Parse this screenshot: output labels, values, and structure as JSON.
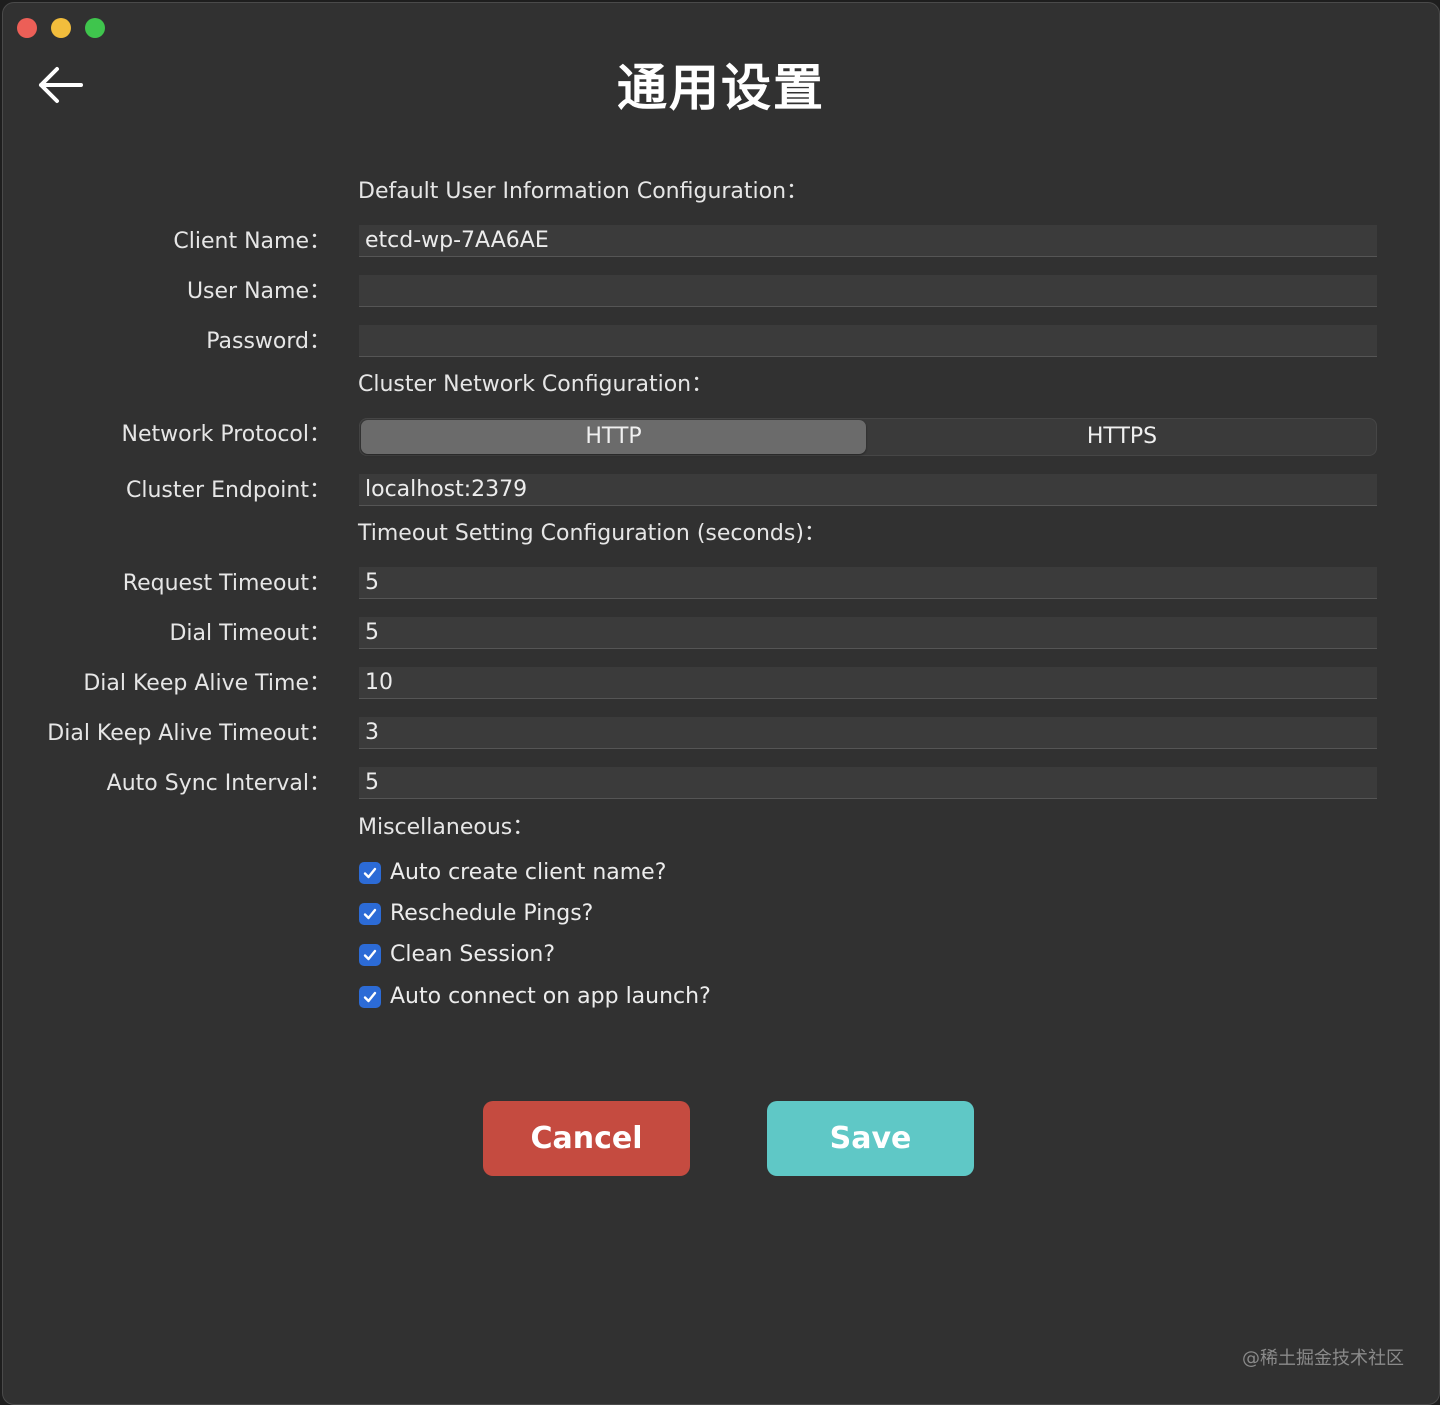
{
  "window": {
    "title": "通用设置"
  },
  "sections": {
    "user_info": "Default User Information Configuration：",
    "network": "Cluster Network Configuration：",
    "timeout": "Timeout Setting Configuration (seconds)：",
    "misc": "Miscellaneous："
  },
  "fields": {
    "client_name": {
      "label": "Client Name：",
      "value": "etcd-wp-7AA6AE"
    },
    "user_name": {
      "label": "User Name：",
      "value": ""
    },
    "password": {
      "label": "Password：",
      "value": ""
    },
    "protocol": {
      "label": "Network Protocol：",
      "options": [
        "HTTP",
        "HTTPS"
      ],
      "selected": "HTTP"
    },
    "endpoint": {
      "label": "Cluster Endpoint：",
      "value": "localhost:2379"
    },
    "request_timeout": {
      "label": "Request Timeout：",
      "value": "5"
    },
    "dial_timeout": {
      "label": "Dial Timeout：",
      "value": "5"
    },
    "keep_alive_time": {
      "label": "Dial Keep Alive Time：",
      "value": "10"
    },
    "keep_alive_timeout": {
      "label": "Dial Keep Alive Timeout：",
      "value": "3"
    },
    "auto_sync": {
      "label": "Auto Sync Interval：",
      "value": "5"
    }
  },
  "checkboxes": [
    {
      "label": "Auto create client name?",
      "checked": true
    },
    {
      "label": "Reschedule Pings?",
      "checked": true
    },
    {
      "label": "Clean Session?",
      "checked": true
    },
    {
      "label": "Auto connect on app launch?",
      "checked": true
    }
  ],
  "buttons": {
    "cancel": "Cancel",
    "save": "Save"
  },
  "watermark": "@稀土掘金技术社区",
  "colors": {
    "background": "#313131",
    "cancel": "#c54b40",
    "save": "#5fc8c6",
    "checkbox": "#2c6bd6"
  }
}
